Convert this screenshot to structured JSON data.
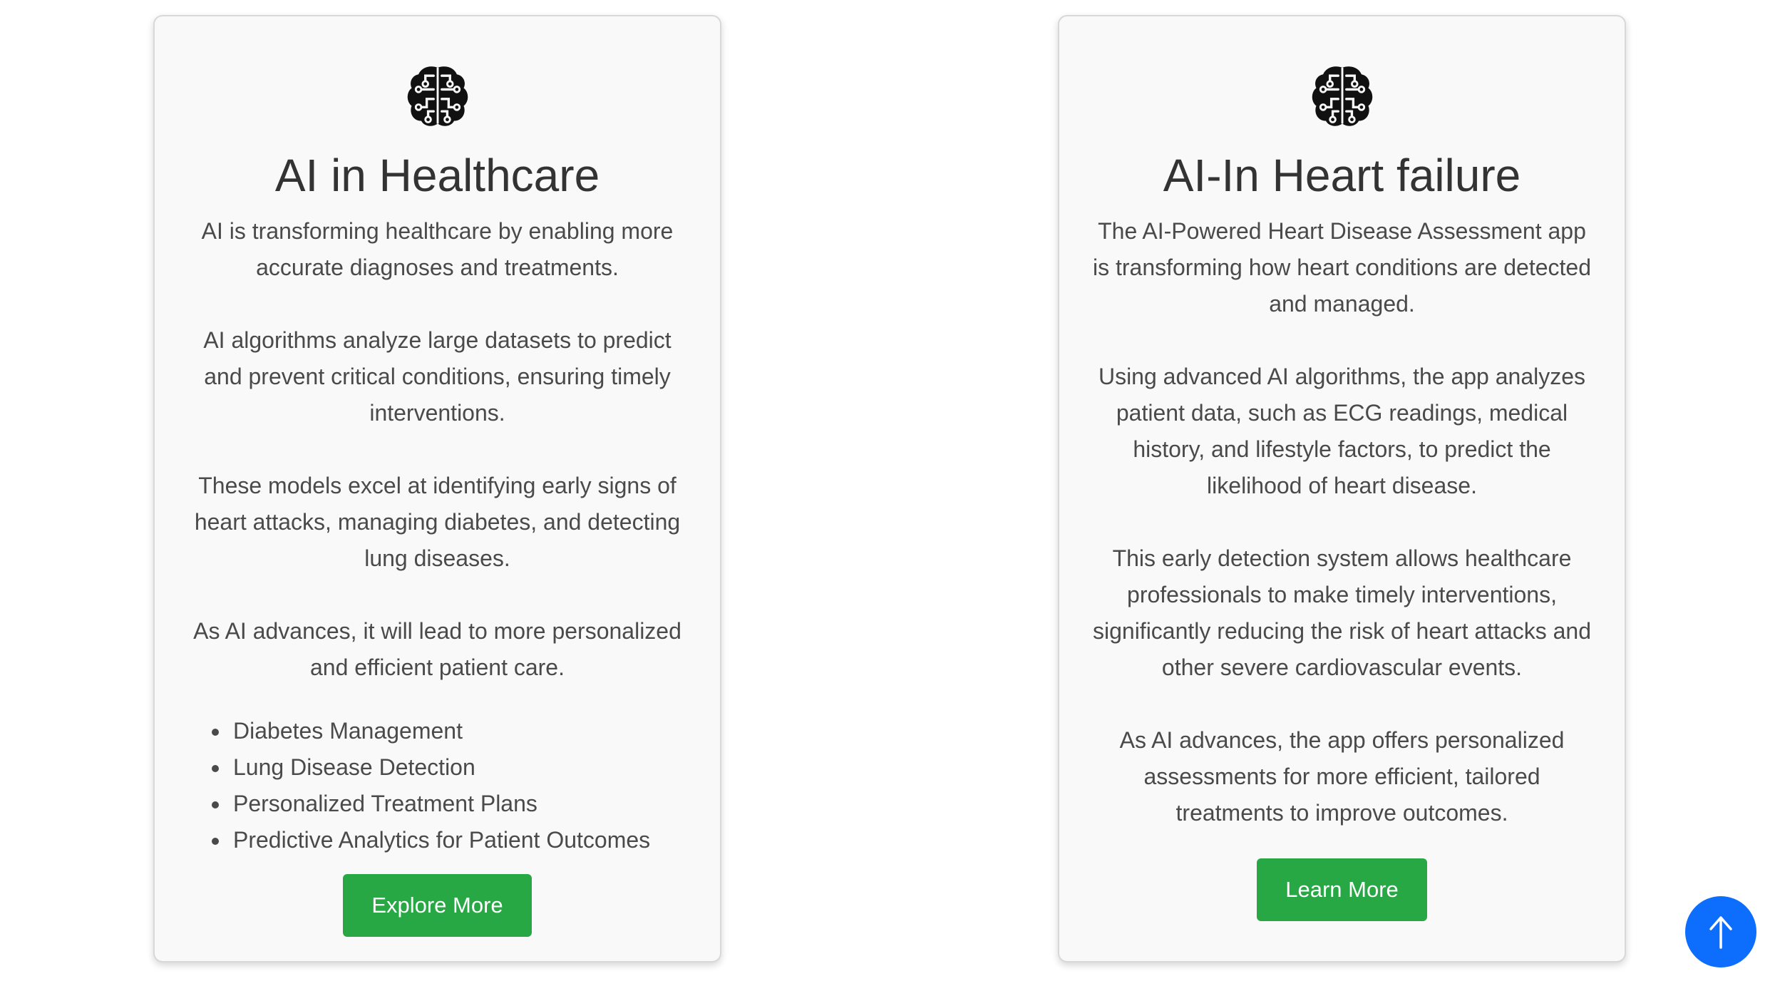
{
  "cards": [
    {
      "icon": "brain-circuit-icon",
      "title": "AI in Healthcare",
      "paragraphs": [
        "AI is transforming healthcare by enabling more accurate diagnoses and treatments.",
        "AI algorithms analyze large datasets to predict and prevent critical conditions, ensuring timely interventions.",
        "These models excel at identifying early signs of heart attacks, managing diabetes, and detecting lung diseases.",
        "As AI advances, it will lead to more personalized and efficient patient care."
      ],
      "list": [
        "Diabetes Management",
        "Lung Disease Detection",
        "Personalized Treatment Plans",
        "Predictive Analytics for Patient Outcomes"
      ],
      "button_label": "Explore More"
    },
    {
      "icon": "brain-circuit-icon",
      "title": "AI-In Heart failure",
      "paragraphs": [
        "The AI-Powered Heart Disease Assessment app is transforming how heart conditions are detected and managed.",
        "Using advanced AI algorithms, the app analyzes patient data, such as ECG readings, medical history, and lifestyle factors, to predict the likelihood of heart disease.",
        "This early detection system allows healthcare professionals to make timely interventions, significantly reducing the risk of heart attacks and other severe cardiovascular events.",
        "As AI advances, the app offers personalized assessments for more efficient, tailored treatments to improve outcomes."
      ],
      "button_label": "Learn More"
    }
  ],
  "scroll_top": {
    "icon": "arrow-up-icon"
  },
  "colors": {
    "button_green": "#27a845",
    "scroll_button_blue": "#0d6efd",
    "card_background": "#f9f9f9"
  }
}
